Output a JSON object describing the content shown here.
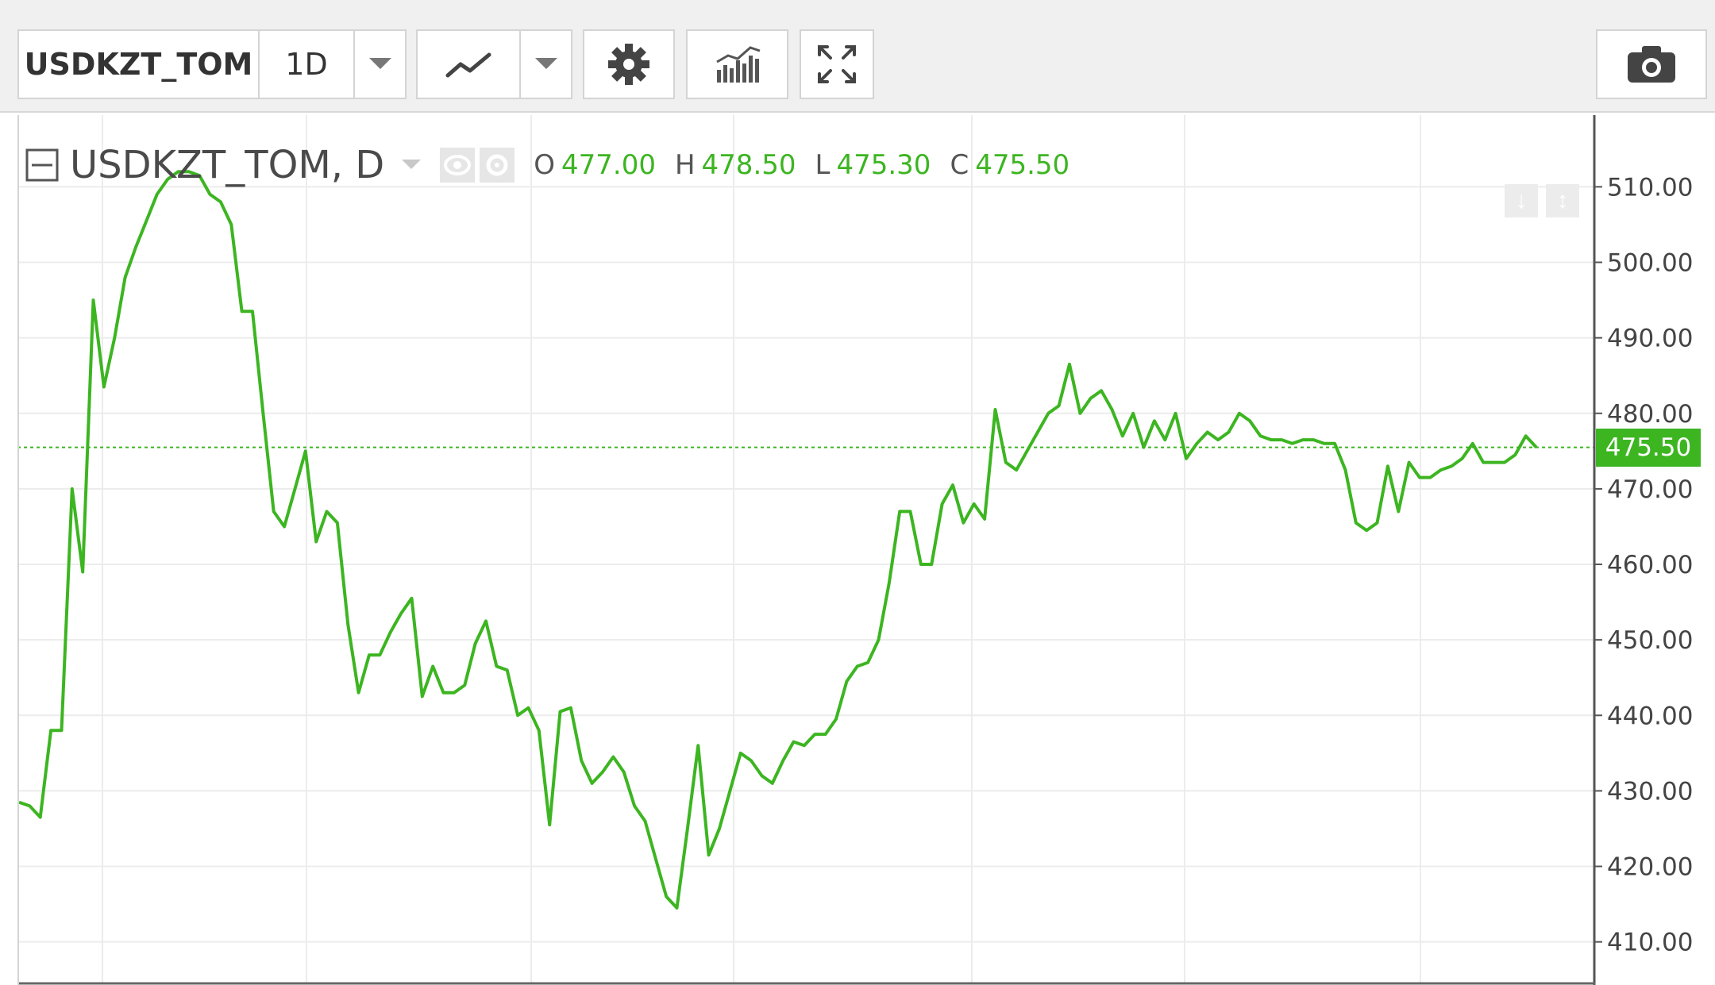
{
  "toolbar": {
    "symbol": "USDKZT_TOM",
    "interval": "1D",
    "icons": [
      "chevron-down-icon",
      "line-chart-icon",
      "chevron-down-icon",
      "gear-icon",
      "indicators-icon",
      "fullscreen-icon",
      "camera-icon"
    ]
  },
  "legend": {
    "title": "USDKZT_TOM, D",
    "o_label": "O",
    "o_value": "477.00",
    "h_label": "H",
    "h_value": "478.50",
    "l_label": "L",
    "l_value": "475.30",
    "c_label": "C",
    "c_value": "475.50"
  },
  "colors": {
    "line": "#3cb521",
    "grid": "#ececec",
    "axis_text": "#444444",
    "price_tag_bg": "#3cb521"
  },
  "price_tag": "475.50",
  "chart_data": {
    "type": "line",
    "title": "USDKZT_TOM, D",
    "ylim": [
      404.5,
      519.5
    ],
    "yticks": [
      410,
      420,
      430,
      440,
      450,
      460,
      470,
      480,
      490,
      500,
      510
    ],
    "ytick_labels": [
      "410.00",
      "420.00",
      "430.00",
      "440.00",
      "450.00",
      "460.00",
      "470.00",
      "480.00",
      "490.00",
      "500.00",
      "510.00"
    ],
    "last_value": 475.5,
    "grid": true,
    "series": [
      {
        "values": [
          428.5,
          428,
          426.5,
          438,
          438,
          470,
          459,
          495,
          483.5,
          490,
          498,
          502,
          505.5,
          509,
          511,
          512,
          512,
          511.5,
          509,
          508,
          505,
          493.5,
          493.5,
          480,
          467,
          465,
          470,
          475,
          463,
          467,
          465.5,
          452,
          443,
          448,
          448,
          451,
          453.5,
          455.5,
          442.5,
          446.5,
          443,
          443,
          444,
          449.5,
          452.5,
          446.5,
          446,
          440,
          441,
          438,
          425.5,
          440.5,
          441,
          434,
          431,
          432.5,
          434.5,
          432.5,
          428,
          426,
          421,
          416,
          414.5,
          425,
          436,
          421.5,
          425,
          430,
          435,
          434,
          432,
          431,
          434,
          436.5,
          436,
          437.5,
          437.5,
          439.5,
          444.5,
          446.5,
          447,
          450,
          457.5,
          467,
          467,
          460,
          460,
          468,
          470.5,
          465.5,
          468,
          466,
          480.5,
          473.5,
          472.5,
          475,
          477.5,
          480,
          481,
          486.5,
          480,
          482,
          483,
          480.5,
          477,
          480,
          475.5,
          479,
          476.5,
          480,
          474,
          476,
          477.5,
          476.5,
          477.5,
          480,
          479,
          477,
          476.5,
          476.5,
          476,
          476.5,
          476.5,
          476,
          476,
          472.5,
          465.5,
          464.5,
          465.5,
          473,
          467,
          473.5,
          471.5,
          471.5,
          472.5,
          473,
          474,
          476,
          473.5,
          473.5,
          473.5,
          474.5,
          477,
          475.5
        ]
      }
    ]
  }
}
